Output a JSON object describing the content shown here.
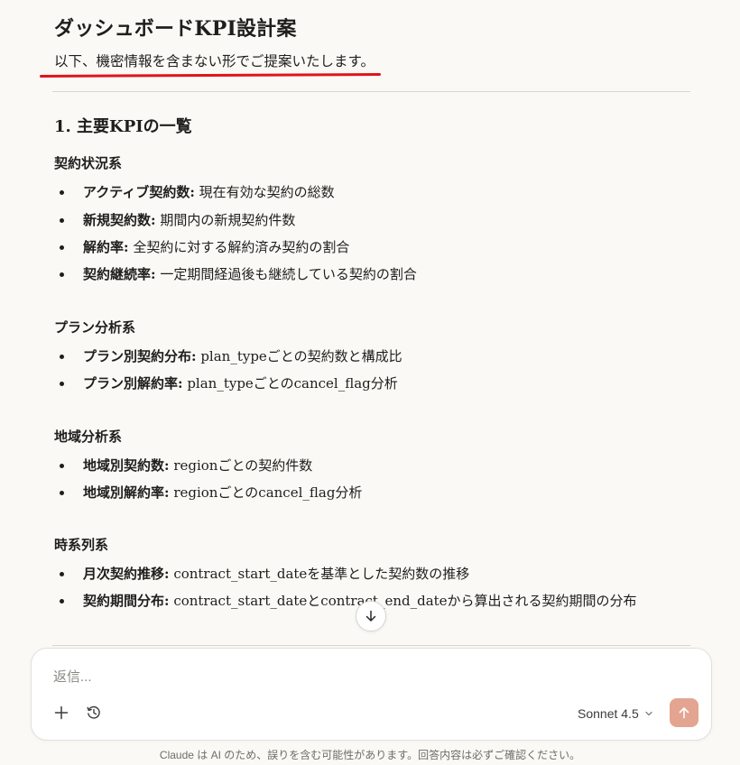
{
  "document": {
    "title": "ダッシュボードKPI設計案",
    "intro": "以下、機密情報を含まない形でご提案いたします。",
    "section_heading": "1. 主要KPIの一覧",
    "groups": [
      {
        "title": "契約状況系",
        "items": [
          {
            "label": "アクティブ契約数:",
            "text": " 現在有効な契約の総数"
          },
          {
            "label": "新規契約数:",
            "text": " 期間内の新規契約件数"
          },
          {
            "label": "解約率:",
            "text": " 全契約に対する解約済み契約の割合"
          },
          {
            "label": "契約継続率:",
            "text": " 一定期間経過後も継続している契約の割合"
          }
        ]
      },
      {
        "title": "プラン分析系",
        "items": [
          {
            "label": "プラン別契約分布:",
            "text": " plan_typeごとの契約数と構成比"
          },
          {
            "label": "プラン別解約率:",
            "text": " plan_typeごとのcancel_flag分析"
          }
        ]
      },
      {
        "title": "地域分析系",
        "items": [
          {
            "label": "地域別契約数:",
            "text": " regionごとの契約件数"
          },
          {
            "label": "地域別解約率:",
            "text": " regionごとのcancel_flag分析"
          }
        ]
      },
      {
        "title": "時系列系",
        "items": [
          {
            "label": "月次契約推移:",
            "text": " contract_start_dateを基準とした契約数の推移"
          },
          {
            "label": "契約期間分布:",
            "text": " contract_start_dateとcontract_end_dateから算出される契約期間の分布"
          }
        ]
      }
    ]
  },
  "composer": {
    "placeholder": "返信...",
    "model_name": "Sonnet 4.5",
    "add_icon": "plus-icon",
    "history_icon": "clock-icon",
    "send_icon": "arrow-up-icon"
  },
  "footer": {
    "disclaimer": "Claude は AI のため、誤りを含む可能性があります。回答内容は必ずご確認ください。"
  },
  "colors": {
    "background": "#faf9f5",
    "text": "#1f1e1d",
    "annotation_underline": "#e0141c",
    "send_button": "#e3a591"
  }
}
